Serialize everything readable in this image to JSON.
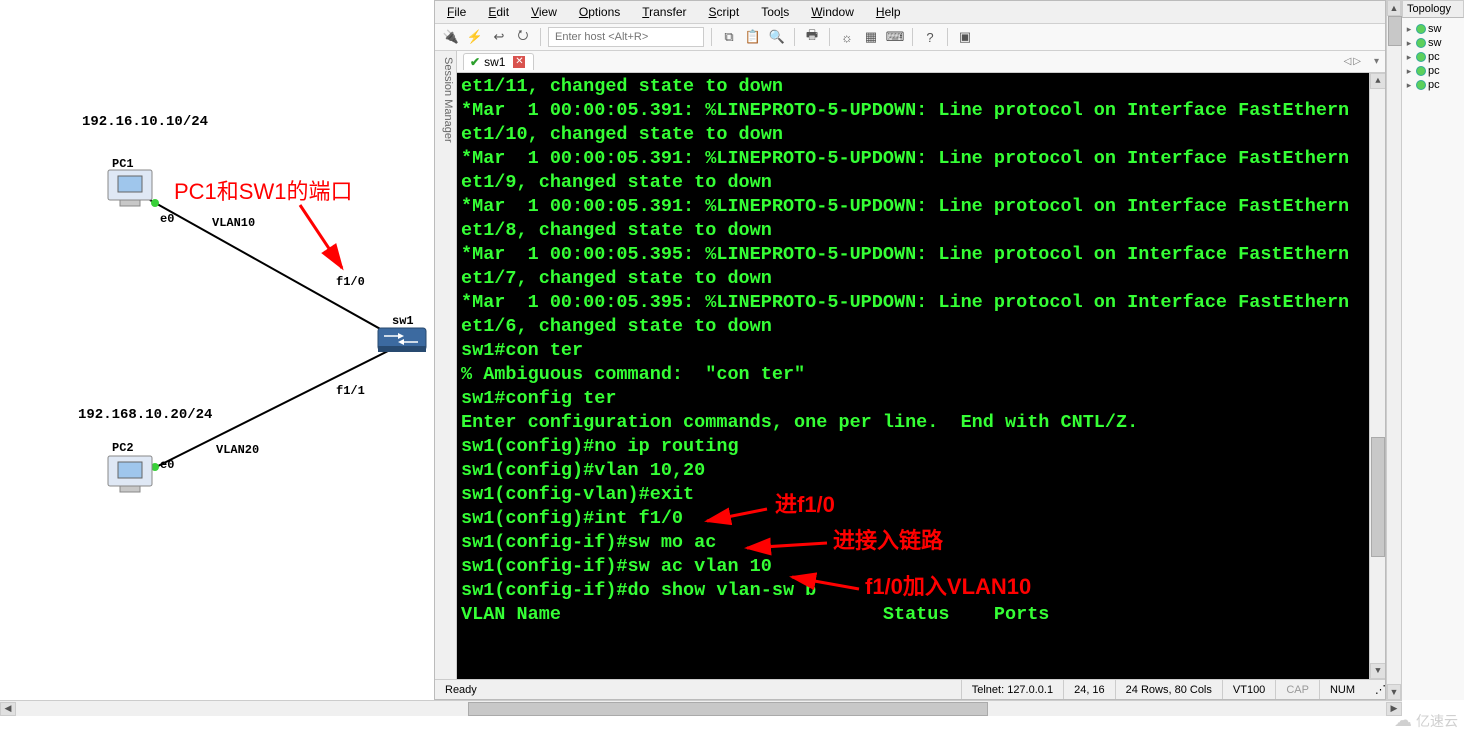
{
  "topology": {
    "ip_pc1": "192.16.10.10/24",
    "ip_pc2": "192.168.10.20/24",
    "pc1_label": "PC1",
    "pc2_label": "PC2",
    "sw_label": "sw1",
    "e0_a": "e0",
    "e0_b": "e0",
    "vlan10": "VLAN10",
    "vlan20": "VLAN20",
    "f10": "f1/0",
    "f11": "f1/1",
    "annotation1": "PC1和SW1的端口"
  },
  "menus": {
    "file": "File",
    "edit": "Edit",
    "view": "View",
    "options": "Options",
    "transfer": "Transfer",
    "script": "Script",
    "tools": "Tools",
    "window": "Window",
    "help": "Help"
  },
  "toolbar": {
    "host_placeholder": "Enter host <Alt+R>"
  },
  "session_mgr_label": "Session Manager",
  "tab": {
    "name": "sw1"
  },
  "terminal_lines": [
    "et1/11, changed state to down",
    "*Mar  1 00:00:05.391: %LINEPROTO-5-UPDOWN: Line protocol on Interface FastEthern",
    "et1/10, changed state to down",
    "*Mar  1 00:00:05.391: %LINEPROTO-5-UPDOWN: Line protocol on Interface FastEthern",
    "et1/9, changed state to down",
    "*Mar  1 00:00:05.391: %LINEPROTO-5-UPDOWN: Line protocol on Interface FastEthern",
    "et1/8, changed state to down",
    "*Mar  1 00:00:05.395: %LINEPROTO-5-UPDOWN: Line protocol on Interface FastEthern",
    "et1/7, changed state to down",
    "*Mar  1 00:00:05.395: %LINEPROTO-5-UPDOWN: Line protocol on Interface FastEthern",
    "et1/6, changed state to down",
    "sw1#con ter",
    "% Ambiguous command:  \"con ter\"",
    "sw1#config ter",
    "Enter configuration commands, one per line.  End with CNTL/Z.",
    "sw1(config)#no ip routing",
    "sw1(config)#vlan 10,20",
    "sw1(config-vlan)#exit",
    "sw1(config)#int f1/0",
    "sw1(config-if)#sw mo ac",
    "sw1(config-if)#sw ac vlan 10",
    "sw1(config-if)#do show vlan-sw b",
    "",
    "VLAN Name                             Status    Ports"
  ],
  "term_annotations": {
    "a1": "进f1/0",
    "a2": "进接入链路",
    "a3": "f1/0加入VLAN10"
  },
  "status": {
    "ready": "Ready",
    "conn": "Telnet: 127.0.0.1",
    "pos": "24,  16",
    "size": "24 Rows, 80 Cols",
    "emu": "VT100",
    "cap": "CAP",
    "num": "NUM"
  },
  "topo_panel": {
    "title": "Topology",
    "items": [
      "sw",
      "sw",
      "pc",
      "pc",
      "pc"
    ]
  },
  "watermark": "亿速云"
}
